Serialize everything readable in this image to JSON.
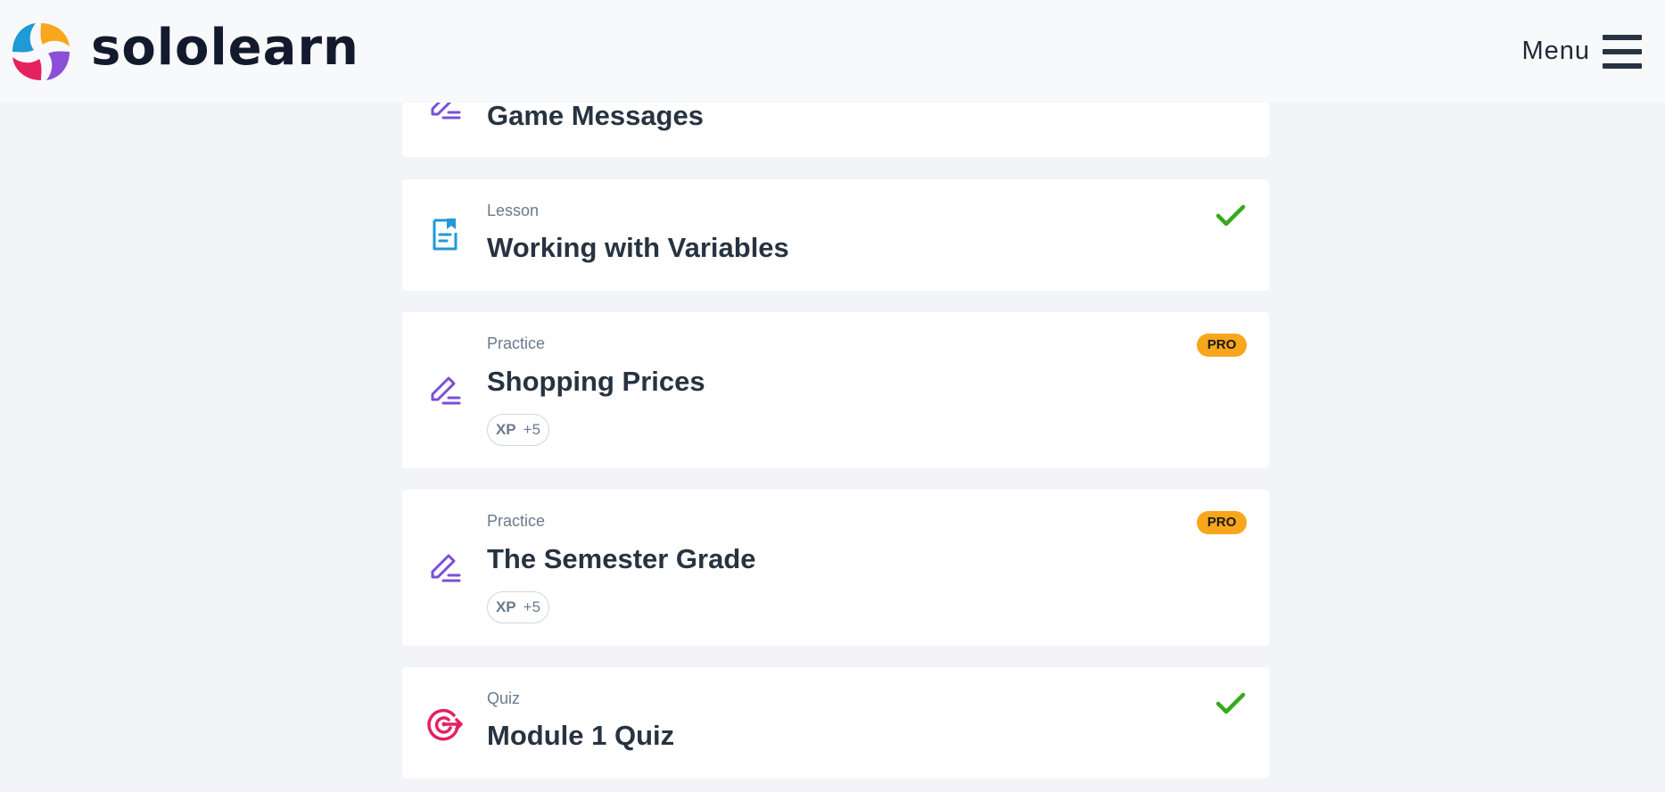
{
  "header": {
    "brand": "sololearn",
    "menu_label": "Menu"
  },
  "items": [
    {
      "type": "",
      "title": "Game Messages",
      "icon": "practice-pencil-icon",
      "status": ""
    },
    {
      "type": "Lesson",
      "title": "Working with Variables",
      "icon": "lesson-bookmark-icon",
      "status": "completed"
    },
    {
      "type": "Practice",
      "title": "Shopping Prices",
      "icon": "practice-pencil-icon",
      "badge": "PRO",
      "xp_label": "XP",
      "xp_value": "+5"
    },
    {
      "type": "Practice",
      "title": "The Semester Grade",
      "icon": "practice-pencil-icon",
      "badge": "PRO",
      "xp_label": "XP",
      "xp_value": "+5"
    },
    {
      "type": "Quiz",
      "title": "Module 1 Quiz",
      "icon": "quiz-target-icon",
      "status": "completed"
    }
  ],
  "colors": {
    "background": "#f2f4f7",
    "card": "#ffffff",
    "header": "#f8f9fa",
    "practice_icon": "#7b4fd8",
    "lesson_icon": "#1e9ad6",
    "quiz_icon": "#e5215f",
    "check": "#3aa81e",
    "pro_badge": "#f8a61c"
  }
}
